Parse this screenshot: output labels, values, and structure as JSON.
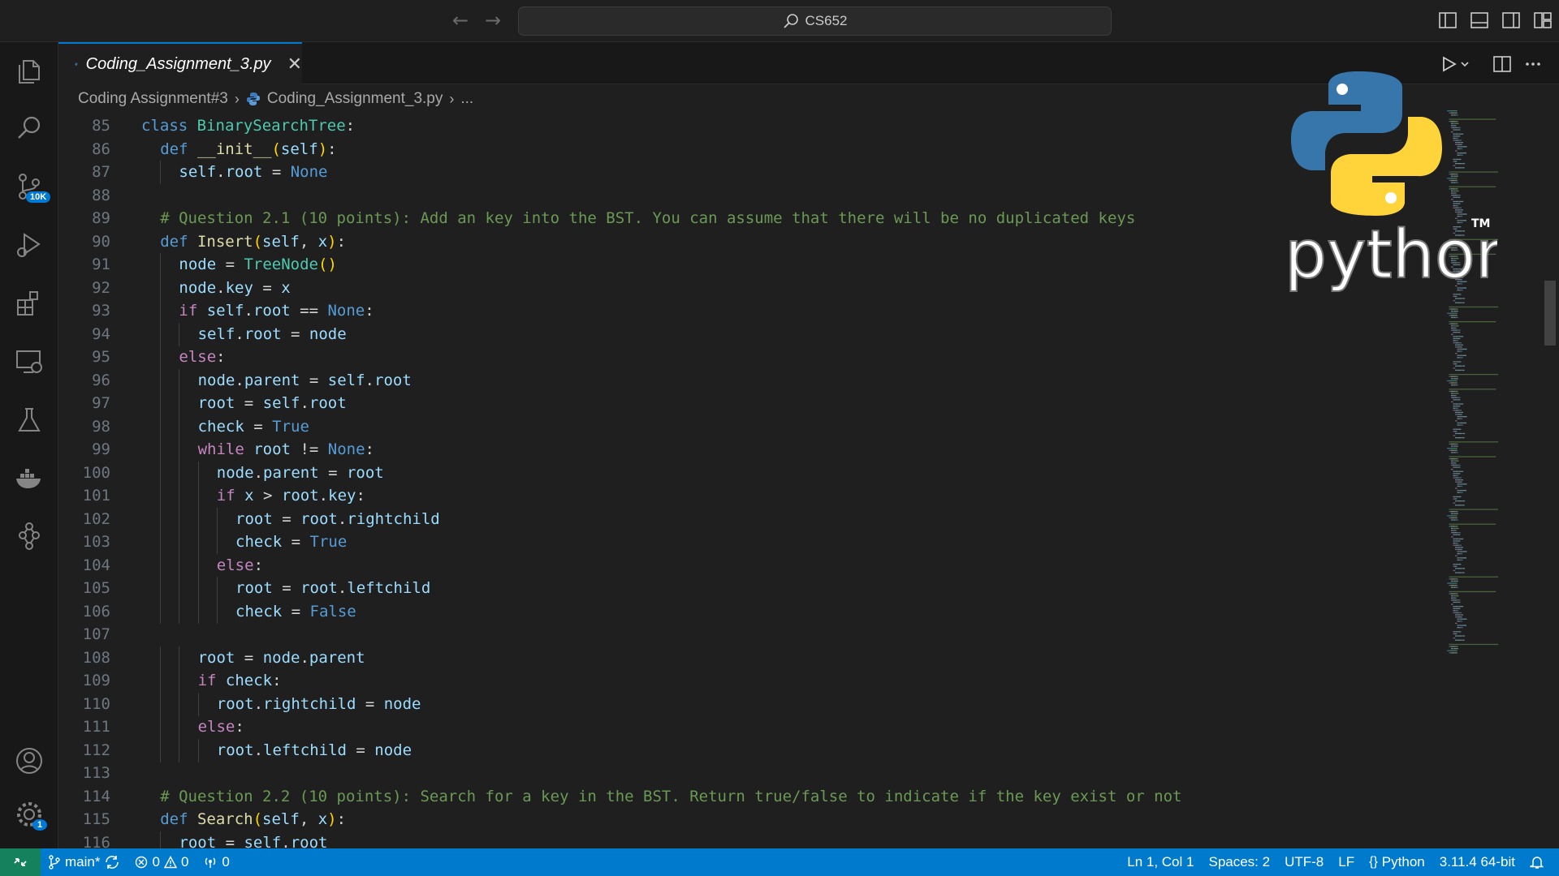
{
  "titlebar": {
    "search_text": "CS652"
  },
  "activitybar": {
    "source_control_badge": "10K",
    "settings_badge": "1"
  },
  "tab": {
    "filename": "Coding_Assignment_3.py",
    "close_glyph": "✕"
  },
  "breadcrumb": {
    "folder": "Coding Assignment#3",
    "file": "Coding_Assignment_3.py",
    "more": "..."
  },
  "editor": {
    "lines": [
      {
        "n": "85",
        "indent": 0,
        "parts": [
          [
            "kw",
            "class "
          ],
          [
            "cls",
            "BinarySearchTree"
          ],
          [
            "pl",
            ":"
          ]
        ]
      },
      {
        "n": "86",
        "indent": 1,
        "parts": [
          [
            "kw",
            "def "
          ],
          [
            "fn",
            "__init__"
          ],
          [
            "br",
            "("
          ],
          [
            "var",
            "self"
          ],
          [
            "br",
            ")"
          ],
          [
            "pl",
            ":"
          ]
        ]
      },
      {
        "n": "87",
        "indent": 2,
        "parts": [
          [
            "var",
            "self"
          ],
          [
            "pl",
            "."
          ],
          [
            "var",
            "root"
          ],
          [
            "pl",
            " = "
          ],
          [
            "const",
            "None"
          ]
        ]
      },
      {
        "n": "88",
        "indent": 0,
        "parts": []
      },
      {
        "n": "89",
        "indent": 1,
        "parts": [
          [
            "cm",
            "# Question 2.1 (10 points): Add an key into the BST. You can assume that there will be no duplicated keys"
          ]
        ]
      },
      {
        "n": "90",
        "indent": 1,
        "parts": [
          [
            "kw",
            "def "
          ],
          [
            "fn",
            "Insert"
          ],
          [
            "br",
            "("
          ],
          [
            "var",
            "self"
          ],
          [
            "pl",
            ", "
          ],
          [
            "var",
            "x"
          ],
          [
            "br",
            ")"
          ],
          [
            "pl",
            ":"
          ]
        ]
      },
      {
        "n": "91",
        "indent": 2,
        "parts": [
          [
            "var",
            "node"
          ],
          [
            "pl",
            " = "
          ],
          [
            "cls",
            "TreeNode"
          ],
          [
            "br",
            "()"
          ]
        ]
      },
      {
        "n": "92",
        "indent": 2,
        "parts": [
          [
            "var",
            "node"
          ],
          [
            "pl",
            "."
          ],
          [
            "var",
            "key"
          ],
          [
            "pl",
            " = "
          ],
          [
            "var",
            "x"
          ]
        ]
      },
      {
        "n": "93",
        "indent": 2,
        "parts": [
          [
            "ctrl",
            "if "
          ],
          [
            "var",
            "self"
          ],
          [
            "pl",
            "."
          ],
          [
            "var",
            "root"
          ],
          [
            "pl",
            " == "
          ],
          [
            "const",
            "None"
          ],
          [
            "pl",
            ":"
          ]
        ]
      },
      {
        "n": "94",
        "indent": 3,
        "parts": [
          [
            "var",
            "self"
          ],
          [
            "pl",
            "."
          ],
          [
            "var",
            "root"
          ],
          [
            "pl",
            " = "
          ],
          [
            "var",
            "node"
          ]
        ]
      },
      {
        "n": "95",
        "indent": 2,
        "parts": [
          [
            "ctrl",
            "else"
          ],
          [
            "pl",
            ":"
          ]
        ]
      },
      {
        "n": "96",
        "indent": 3,
        "parts": [
          [
            "var",
            "node"
          ],
          [
            "pl",
            "."
          ],
          [
            "var",
            "parent"
          ],
          [
            "pl",
            " = "
          ],
          [
            "var",
            "self"
          ],
          [
            "pl",
            "."
          ],
          [
            "var",
            "root"
          ]
        ]
      },
      {
        "n": "97",
        "indent": 3,
        "parts": [
          [
            "var",
            "root"
          ],
          [
            "pl",
            " = "
          ],
          [
            "var",
            "self"
          ],
          [
            "pl",
            "."
          ],
          [
            "var",
            "root"
          ]
        ]
      },
      {
        "n": "98",
        "indent": 3,
        "parts": [
          [
            "var",
            "check"
          ],
          [
            "pl",
            " = "
          ],
          [
            "const",
            "True"
          ]
        ]
      },
      {
        "n": "99",
        "indent": 3,
        "parts": [
          [
            "ctrl",
            "while "
          ],
          [
            "var",
            "root"
          ],
          [
            "pl",
            " != "
          ],
          [
            "const",
            "None"
          ],
          [
            "pl",
            ":"
          ]
        ]
      },
      {
        "n": "100",
        "indent": 4,
        "parts": [
          [
            "var",
            "node"
          ],
          [
            "pl",
            "."
          ],
          [
            "var",
            "parent"
          ],
          [
            "pl",
            " = "
          ],
          [
            "var",
            "root"
          ]
        ]
      },
      {
        "n": "101",
        "indent": 4,
        "parts": [
          [
            "ctrl",
            "if "
          ],
          [
            "var",
            "x"
          ],
          [
            "pl",
            " > "
          ],
          [
            "var",
            "root"
          ],
          [
            "pl",
            "."
          ],
          [
            "var",
            "key"
          ],
          [
            "pl",
            ":"
          ]
        ]
      },
      {
        "n": "102",
        "indent": 5,
        "parts": [
          [
            "var",
            "root"
          ],
          [
            "pl",
            " = "
          ],
          [
            "var",
            "root"
          ],
          [
            "pl",
            "."
          ],
          [
            "var",
            "rightchild"
          ]
        ]
      },
      {
        "n": "103",
        "indent": 5,
        "parts": [
          [
            "var",
            "check"
          ],
          [
            "pl",
            " = "
          ],
          [
            "const",
            "True"
          ]
        ]
      },
      {
        "n": "104",
        "indent": 4,
        "parts": [
          [
            "ctrl",
            "else"
          ],
          [
            "pl",
            ":"
          ]
        ]
      },
      {
        "n": "105",
        "indent": 5,
        "parts": [
          [
            "var",
            "root"
          ],
          [
            "pl",
            " = "
          ],
          [
            "var",
            "root"
          ],
          [
            "pl",
            "."
          ],
          [
            "var",
            "leftchild"
          ]
        ]
      },
      {
        "n": "106",
        "indent": 5,
        "parts": [
          [
            "var",
            "check"
          ],
          [
            "pl",
            " = "
          ],
          [
            "const",
            "False"
          ]
        ]
      },
      {
        "n": "107",
        "indent": 0,
        "parts": []
      },
      {
        "n": "108",
        "indent": 3,
        "parts": [
          [
            "var",
            "root"
          ],
          [
            "pl",
            " = "
          ],
          [
            "var",
            "node"
          ],
          [
            "pl",
            "."
          ],
          [
            "var",
            "parent"
          ]
        ]
      },
      {
        "n": "109",
        "indent": 3,
        "parts": [
          [
            "ctrl",
            "if "
          ],
          [
            "var",
            "check"
          ],
          [
            "pl",
            ":"
          ]
        ]
      },
      {
        "n": "110",
        "indent": 4,
        "parts": [
          [
            "var",
            "root"
          ],
          [
            "pl",
            "."
          ],
          [
            "var",
            "rightchild"
          ],
          [
            "pl",
            " = "
          ],
          [
            "var",
            "node"
          ]
        ]
      },
      {
        "n": "111",
        "indent": 3,
        "parts": [
          [
            "ctrl",
            "else"
          ],
          [
            "pl",
            ":"
          ]
        ]
      },
      {
        "n": "112",
        "indent": 4,
        "parts": [
          [
            "var",
            "root"
          ],
          [
            "pl",
            "."
          ],
          [
            "var",
            "leftchild"
          ],
          [
            "pl",
            " = "
          ],
          [
            "var",
            "node"
          ]
        ]
      },
      {
        "n": "113",
        "indent": 0,
        "parts": []
      },
      {
        "n": "114",
        "indent": 1,
        "parts": [
          [
            "cm",
            "# Question 2.2 (10 points): Search for a key in the BST. Return true/false to indicate if the key exist or not"
          ]
        ]
      },
      {
        "n": "115",
        "indent": 1,
        "parts": [
          [
            "kw",
            "def "
          ],
          [
            "fn",
            "Search"
          ],
          [
            "br",
            "("
          ],
          [
            "var",
            "self"
          ],
          [
            "pl",
            ", "
          ],
          [
            "var",
            "x"
          ],
          [
            "br",
            ")"
          ],
          [
            "pl",
            ":"
          ]
        ]
      },
      {
        "n": "116",
        "indent": 2,
        "parts": [
          [
            "var",
            "root"
          ],
          [
            "pl",
            " = "
          ],
          [
            "var",
            "self"
          ],
          [
            "pl",
            "."
          ],
          [
            "var",
            "root"
          ]
        ]
      }
    ]
  },
  "logo": {
    "wordmark": "python",
    "trademark": "TM"
  },
  "statusbar": {
    "branch": "main*",
    "errors": "0",
    "warnings": "0",
    "ports": "0",
    "position": "Ln 1, Col 1",
    "spaces": "Spaces: 2",
    "encoding": "UTF-8",
    "eol": "LF",
    "language": "Python",
    "interpreter": "3.11.4 64-bit"
  },
  "colors": {
    "statusbar": "#007acc",
    "remote": "#16825d",
    "accent": "#0078d4"
  }
}
